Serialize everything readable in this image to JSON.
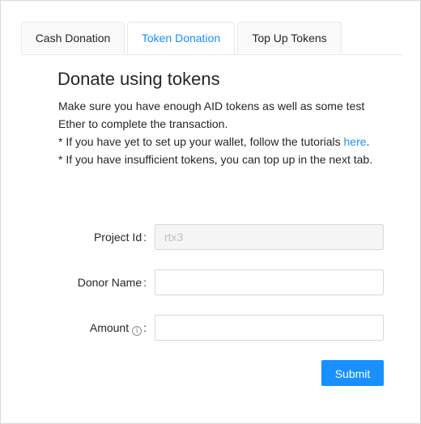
{
  "tabs": [
    {
      "label": "Cash Donation",
      "active": false
    },
    {
      "label": "Token Donation",
      "active": true
    },
    {
      "label": "Top Up Tokens",
      "active": false
    }
  ],
  "content": {
    "heading": "Donate using tokens",
    "line1": "Make sure you have enough AID tokens as well as some test Ether to complete the transaction.",
    "line2_prefix": "* If you have yet to set up your wallet, follow the tutorials ",
    "line2_link": "here",
    "line2_suffix": ".",
    "line3": "* If you have insufficient tokens, you can top up in the next tab."
  },
  "form": {
    "project_id": {
      "label": "Project Id",
      "value": "rtx3"
    },
    "donor_name": {
      "label": "Donor Name",
      "value": ""
    },
    "amount": {
      "label": "Amount",
      "value": "",
      "icon": "info-icon"
    },
    "colon": ":",
    "submit_label": "Submit"
  },
  "colors": {
    "accent": "#1890ff",
    "disabled_bg": "#f5f5f5",
    "border": "#d9d9d9"
  }
}
